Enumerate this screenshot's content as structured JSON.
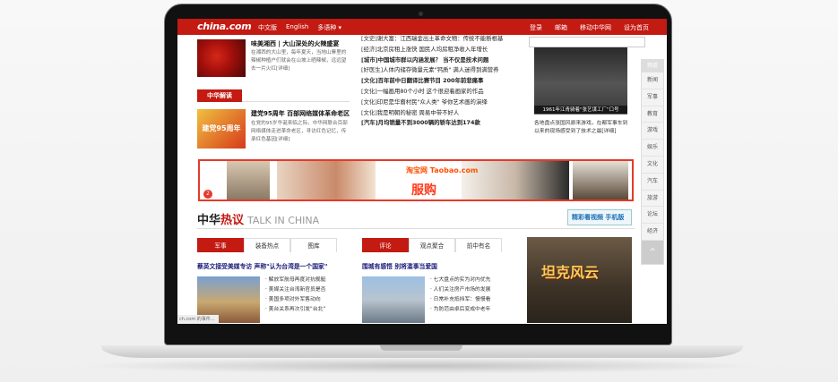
{
  "topbar": {
    "logo": "china.com",
    "nav": [
      "中文版",
      "English",
      "多语种 ▾"
    ],
    "right": [
      "登录",
      "邮箱",
      "移动中华网",
      "设为首页"
    ]
  },
  "left": {
    "chili_title": "味美湘西 | 大山深处的火辣盛宴",
    "chili_desc": "在湘西的大山里，每年夏天，当地山寨里的辣椒种植户们就会在山坡上晒辣椒，远远望去一片火红[详细]",
    "section_tag": "中华解读",
    "party_img_text": "建党95周年",
    "party_title": "建党95周年 百部网络媒体革命老区",
    "party_desc": "在党的95岁华诞来临之际，中华网联合百部网络媒体走进革命老区，寻访红色记忆，传承红色基因[详细]"
  },
  "news": [
    {
      "cat": "[文史]",
      "text": "谢大富：江西瑞金出土革命文物：传统不能断根基",
      "hl": false
    },
    {
      "cat": "[经济]",
      "text": "北京房租上涨快 国民人均房租净收入年增长",
      "hl": false
    },
    {
      "cat": "[城市]",
      "text": "中国城市群以内涵发展？ 当不仅是技术问题",
      "hl": true
    },
    {
      "cat": "[好医生]",
      "text": "人体内储存微量元素\"钙质\" 满人迷得到满营养",
      "hl": false
    },
    {
      "cat": "[文化]",
      "text": "百年前中日翻译比赛节目 200年前悲痛事",
      "hl": true
    },
    {
      "cat": "[文化]",
      "text": "一幅画用80个小时 这个很迎着画家的作品",
      "hl": false
    },
    {
      "cat": "[文化]",
      "text": "印尼是华裔村民\"众人类\" 爷你艺术画的演绎",
      "hl": false
    },
    {
      "cat": "[文化]",
      "text": "我是明朝的秘密 周易中带不好人",
      "hl": false
    },
    {
      "cat": "[汽车]",
      "text": "月均销量不到3000辆的轿车达到174款",
      "hl": true
    }
  ],
  "right": {
    "photo_caption": "1961年江青骑着\"张艺谋工厂\"口号",
    "desc": "各地盘点张国风原来游戏，在都军事车到以来的现场感受到了技术之最[详细]"
  },
  "sidenav": {
    "head": "频道",
    "items": [
      "新闻",
      "军事",
      "教育",
      "游戏",
      "娱乐",
      "文化",
      "汽车",
      "旅游",
      "论坛",
      "经济"
    ],
    "top": "^"
  },
  "banner": {
    "logo": "淘宝网 Taobao.com",
    "big": "服购",
    "num": "2"
  },
  "hot": {
    "title_a": "中华",
    "title_b": "热议",
    "title_en": "TALK IN CHINA",
    "video_btn": "精彩看视频 手机版"
  },
  "tabs_left": [
    "军事",
    "装备热点",
    "图库"
  ],
  "tabs_mid": [
    "评论",
    "观点聚合",
    "前中有名"
  ],
  "article_left": {
    "title": "蔡英文接受美媒专访 声称\"认为台湾是一个国家\"",
    "list": [
      "· 解放军航母再度对抗舰艇",
      "· 美媒关注台湾新官员是否",
      "· 美国多项对外军售动向",
      "· 美台关系再次引发\"台北\""
    ]
  },
  "article_mid": {
    "title": "围城有感悟 别将滥事当爱国",
    "list": [
      "· 七大盘点的实为对内优先",
      "· 人们关注房产市场的发展",
      "· 日常补充抵挡军：慢慢看",
      "· 为防范由卓后变成中老年"
    ]
  },
  "game_ad": {
    "text": "坦克风云"
  },
  "status_bar": "ch.com 的事件..."
}
